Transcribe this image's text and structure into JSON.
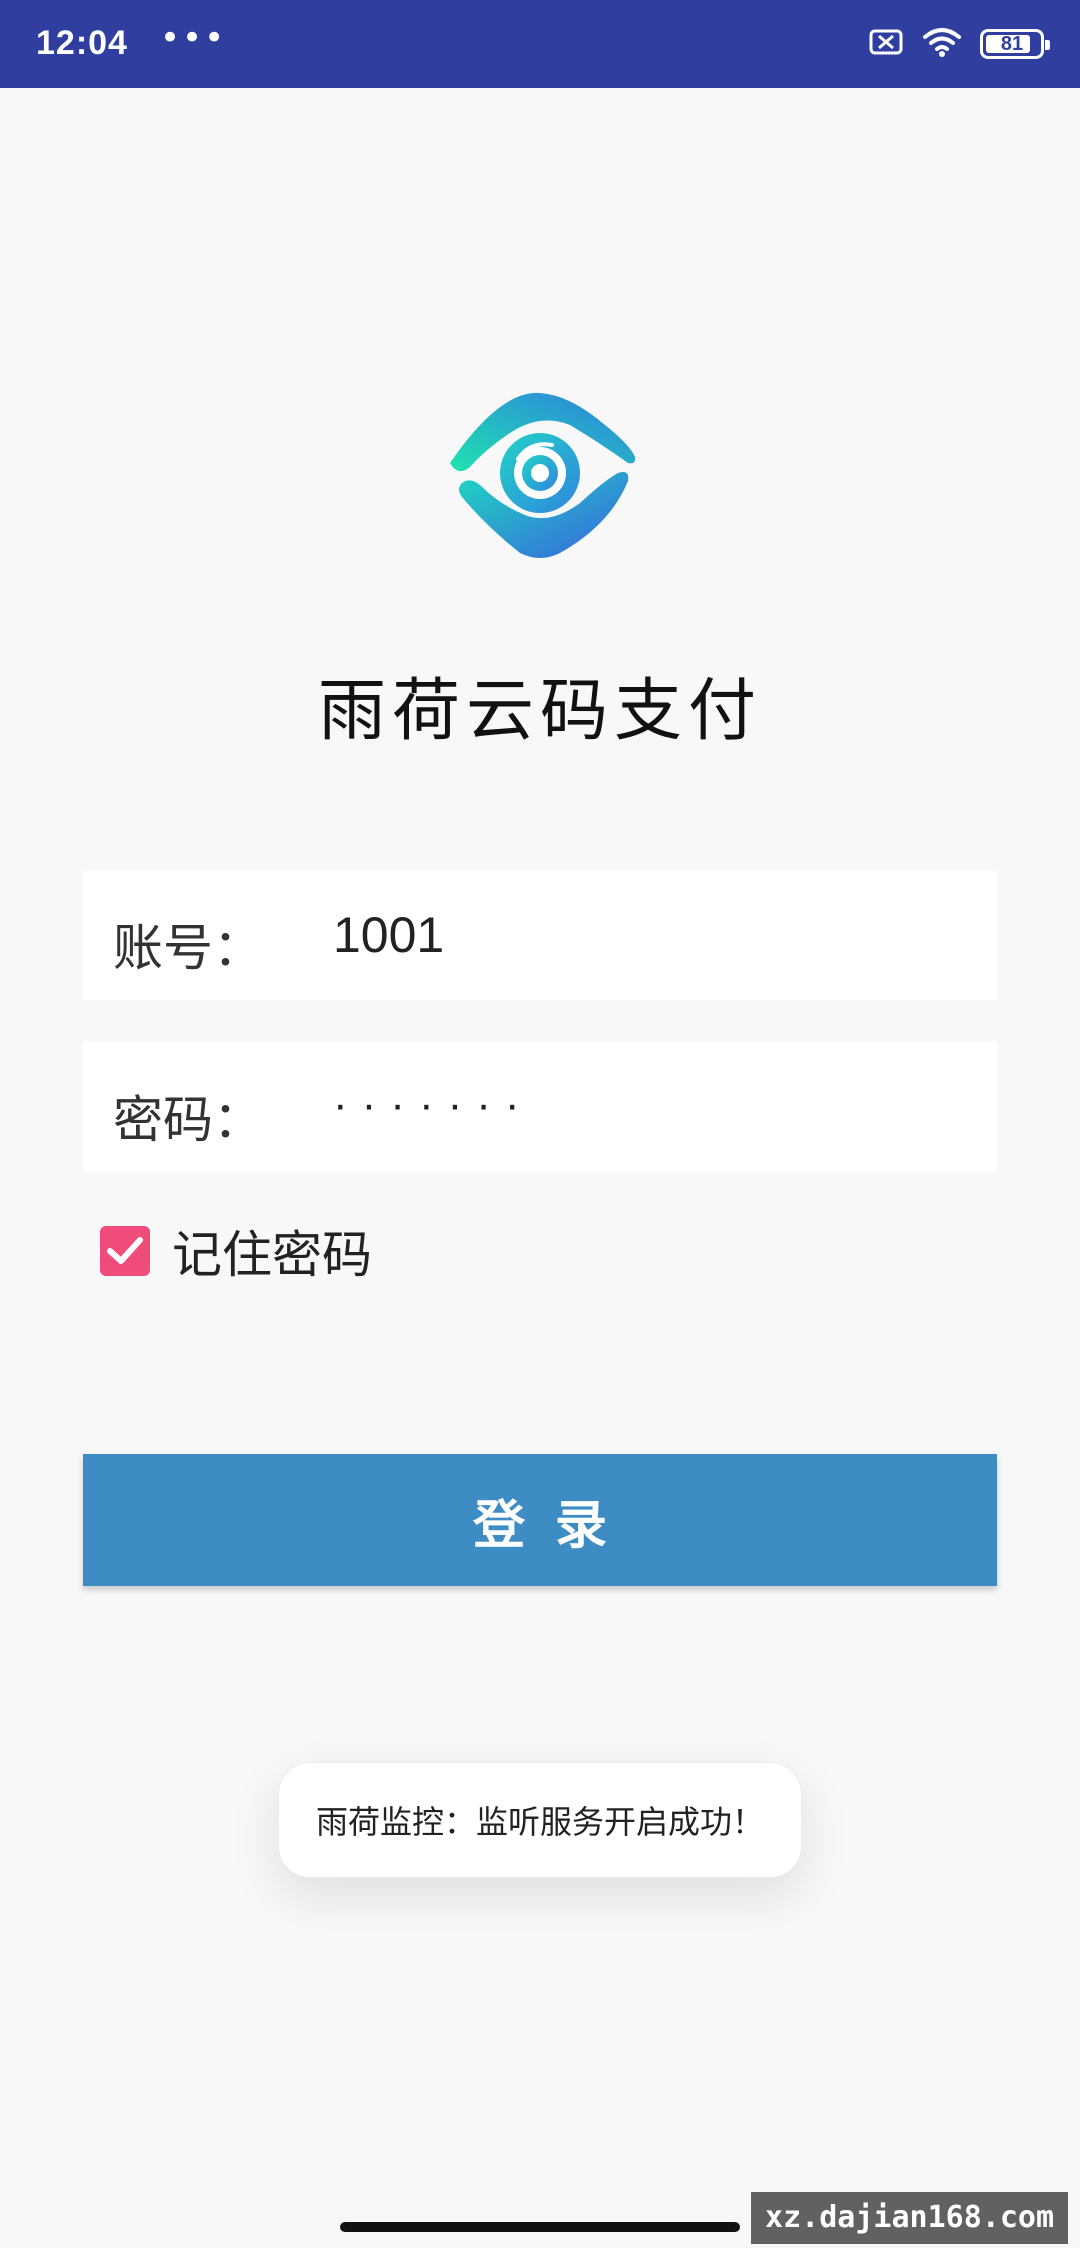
{
  "status_bar": {
    "time": "12:04",
    "dots": "•••",
    "battery_level": "81",
    "icons": [
      "sim-off-icon",
      "wifi-icon",
      "battery-icon"
    ]
  },
  "app": {
    "title": "雨荷云码支付",
    "logo": "eye-logo-icon"
  },
  "form": {
    "account_label": "账号：",
    "account_value": "1001",
    "password_label": "密码：",
    "password_value": "·······",
    "remember_label": "记住密码",
    "remember_checked": true,
    "login_label": "登录"
  },
  "toast": {
    "message": "雨荷监控：监听服务开启成功！"
  },
  "watermark": "xz.dajian168.com",
  "colors": {
    "status_bar": "#303f9f",
    "login_button": "#3d8cc4",
    "checkbox": "#ef4b7b",
    "background": "#f8f8f9"
  }
}
